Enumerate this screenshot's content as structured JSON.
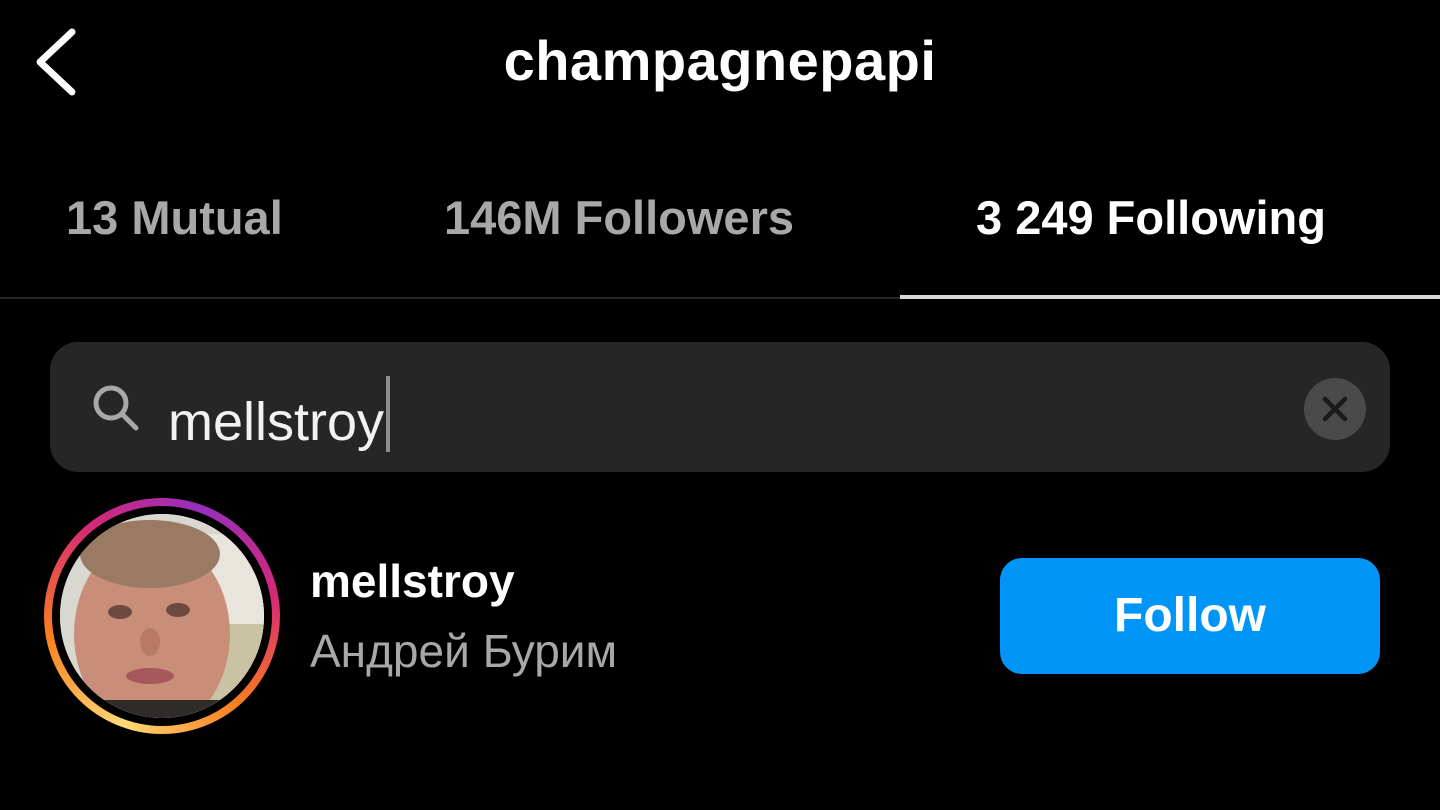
{
  "header": {
    "title": "champagnepapi",
    "back_icon": "chevron-left-icon"
  },
  "tabs": [
    {
      "label": "13 Mutual",
      "active": false
    },
    {
      "label": "146M Followers",
      "active": false
    },
    {
      "label": "3 249 Following",
      "active": true
    }
  ],
  "search": {
    "icon": "search-icon",
    "value": "mellstroy",
    "clear_icon": "clear-x-icon"
  },
  "results": [
    {
      "username": "mellstroy",
      "full_name": "Андрей Бурим",
      "has_story": true,
      "follow_label": "Follow"
    }
  ],
  "colors": {
    "background": "#000000",
    "accent": "#0095f6",
    "inactive_text": "#a8a8a8",
    "search_bg": "#262626"
  }
}
